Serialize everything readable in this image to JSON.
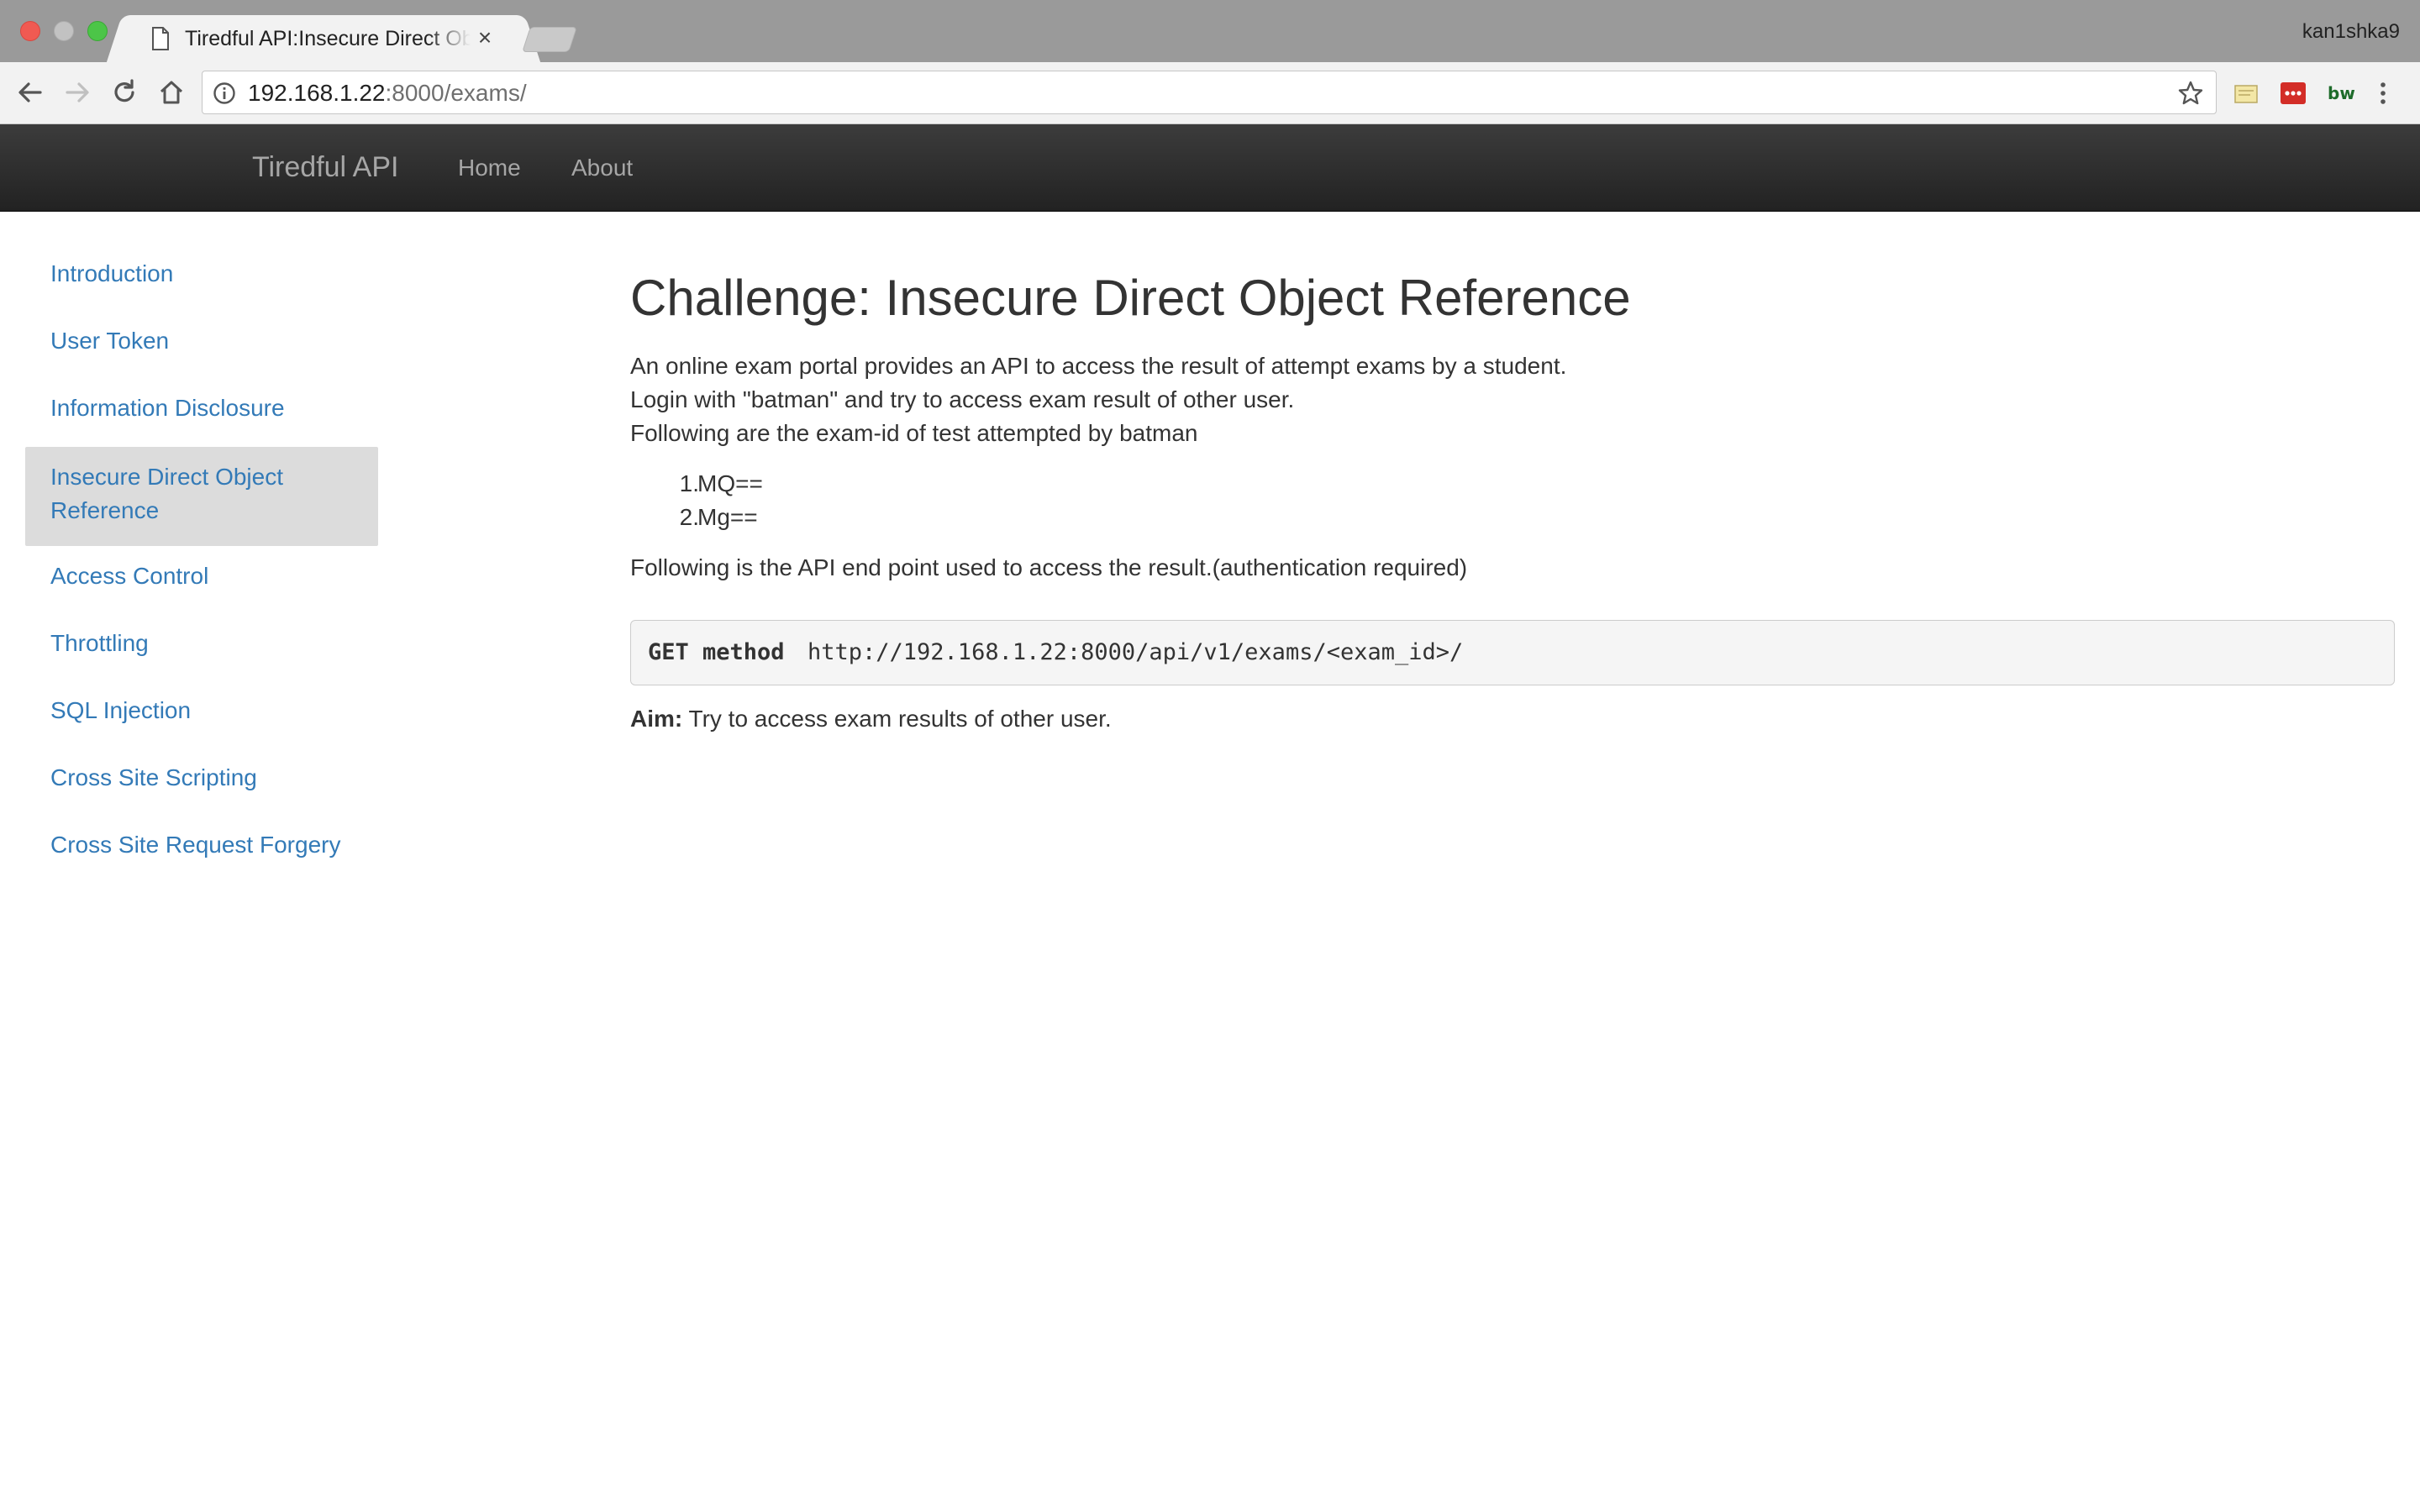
{
  "browser": {
    "tab_title": "Tiredful API:Insecure Direct Object Reference",
    "tab_close": "×",
    "profile_name": "kan1shka9",
    "url_host": "192.168.1.22",
    "url_rest": ":8000/exams/"
  },
  "site": {
    "brand": "Tiredful API",
    "nav": {
      "home": "Home",
      "about": "About"
    }
  },
  "sidebar": {
    "items": [
      {
        "label": "Introduction"
      },
      {
        "label": "User Token"
      },
      {
        "label": "Information Disclosure"
      },
      {
        "label": "Insecure Direct Object Reference",
        "active": true
      },
      {
        "label": "Access Control"
      },
      {
        "label": "Throttling"
      },
      {
        "label": "SQL Injection"
      },
      {
        "label": "Cross Site Scripting"
      },
      {
        "label": "Cross Site Request Forgery"
      }
    ]
  },
  "main": {
    "title": "Challenge: Insecure Direct Object Reference",
    "intro_lines": [
      "An online exam portal provides an API to access the result of attempt exams by a student.",
      "Login with \"batman\" and try to access exam result of other user.",
      "Following are the exam-id of test attempted by batman"
    ],
    "exam_ids": [
      {
        "num": "1.",
        "value": "MQ=="
      },
      {
        "num": "2.",
        "value": "Mg=="
      }
    ],
    "endpoint_text": "Following is the API end point used to access the result.(authentication required)",
    "code": {
      "method": "GET method",
      "url": "http://192.168.1.22:8000/api/v1/exams/<exam_id>/"
    },
    "aim_label": "Aim:",
    "aim_text": " Try to access exam results of other user."
  }
}
